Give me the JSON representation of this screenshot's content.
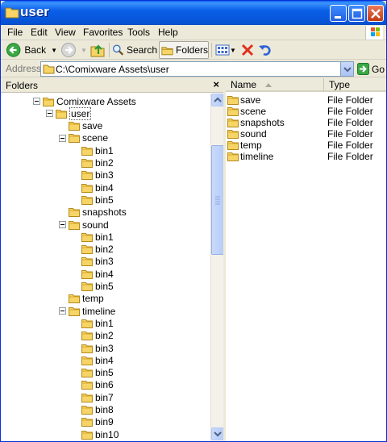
{
  "window": {
    "title": "user",
    "colors": {
      "titlebar": "#0a5fe8",
      "selection_border": "#555555",
      "folder": "#f6d566"
    }
  },
  "menu": {
    "items": [
      "File",
      "Edit",
      "View",
      "Favorites",
      "Tools",
      "Help"
    ]
  },
  "toolbar": {
    "back_label": "Back",
    "search_label": "Search",
    "folders_label": "Folders"
  },
  "address": {
    "label": "Address",
    "value": "C:\\Comixware Assets\\user",
    "go_label": "Go"
  },
  "folders_pane": {
    "title": "Folders",
    "close_glyph": "×",
    "tree": [
      {
        "label": "Comixware Assets",
        "depth": 0,
        "expanded": true
      },
      {
        "label": "user",
        "depth": 1,
        "expanded": true,
        "selected": true
      },
      {
        "label": "save",
        "depth": 2
      },
      {
        "label": "scene",
        "depth": 2,
        "expanded": true
      },
      {
        "label": "bin1",
        "depth": 3
      },
      {
        "label": "bin2",
        "depth": 3
      },
      {
        "label": "bin3",
        "depth": 3
      },
      {
        "label": "bin4",
        "depth": 3
      },
      {
        "label": "bin5",
        "depth": 3
      },
      {
        "label": "snapshots",
        "depth": 2
      },
      {
        "label": "sound",
        "depth": 2,
        "expanded": true
      },
      {
        "label": "bin1",
        "depth": 3
      },
      {
        "label": "bin2",
        "depth": 3
      },
      {
        "label": "bin3",
        "depth": 3
      },
      {
        "label": "bin4",
        "depth": 3
      },
      {
        "label": "bin5",
        "depth": 3
      },
      {
        "label": "temp",
        "depth": 2
      },
      {
        "label": "timeline",
        "depth": 2,
        "expanded": true
      },
      {
        "label": "bin1",
        "depth": 3
      },
      {
        "label": "bin2",
        "depth": 3
      },
      {
        "label": "bin3",
        "depth": 3
      },
      {
        "label": "bin4",
        "depth": 3
      },
      {
        "label": "bin5",
        "depth": 3
      },
      {
        "label": "bin6",
        "depth": 3
      },
      {
        "label": "bin7",
        "depth": 3
      },
      {
        "label": "bin8",
        "depth": 3
      },
      {
        "label": "bin9",
        "depth": 3
      },
      {
        "label": "bin10",
        "depth": 3
      }
    ]
  },
  "details": {
    "columns": {
      "name": "Name",
      "type": "Type"
    },
    "rows": [
      {
        "name": "save",
        "type": "File Folder"
      },
      {
        "name": "scene",
        "type": "File Folder"
      },
      {
        "name": "snapshots",
        "type": "File Folder"
      },
      {
        "name": "sound",
        "type": "File Folder"
      },
      {
        "name": "temp",
        "type": "File Folder"
      },
      {
        "name": "timeline",
        "type": "File Folder"
      }
    ]
  }
}
